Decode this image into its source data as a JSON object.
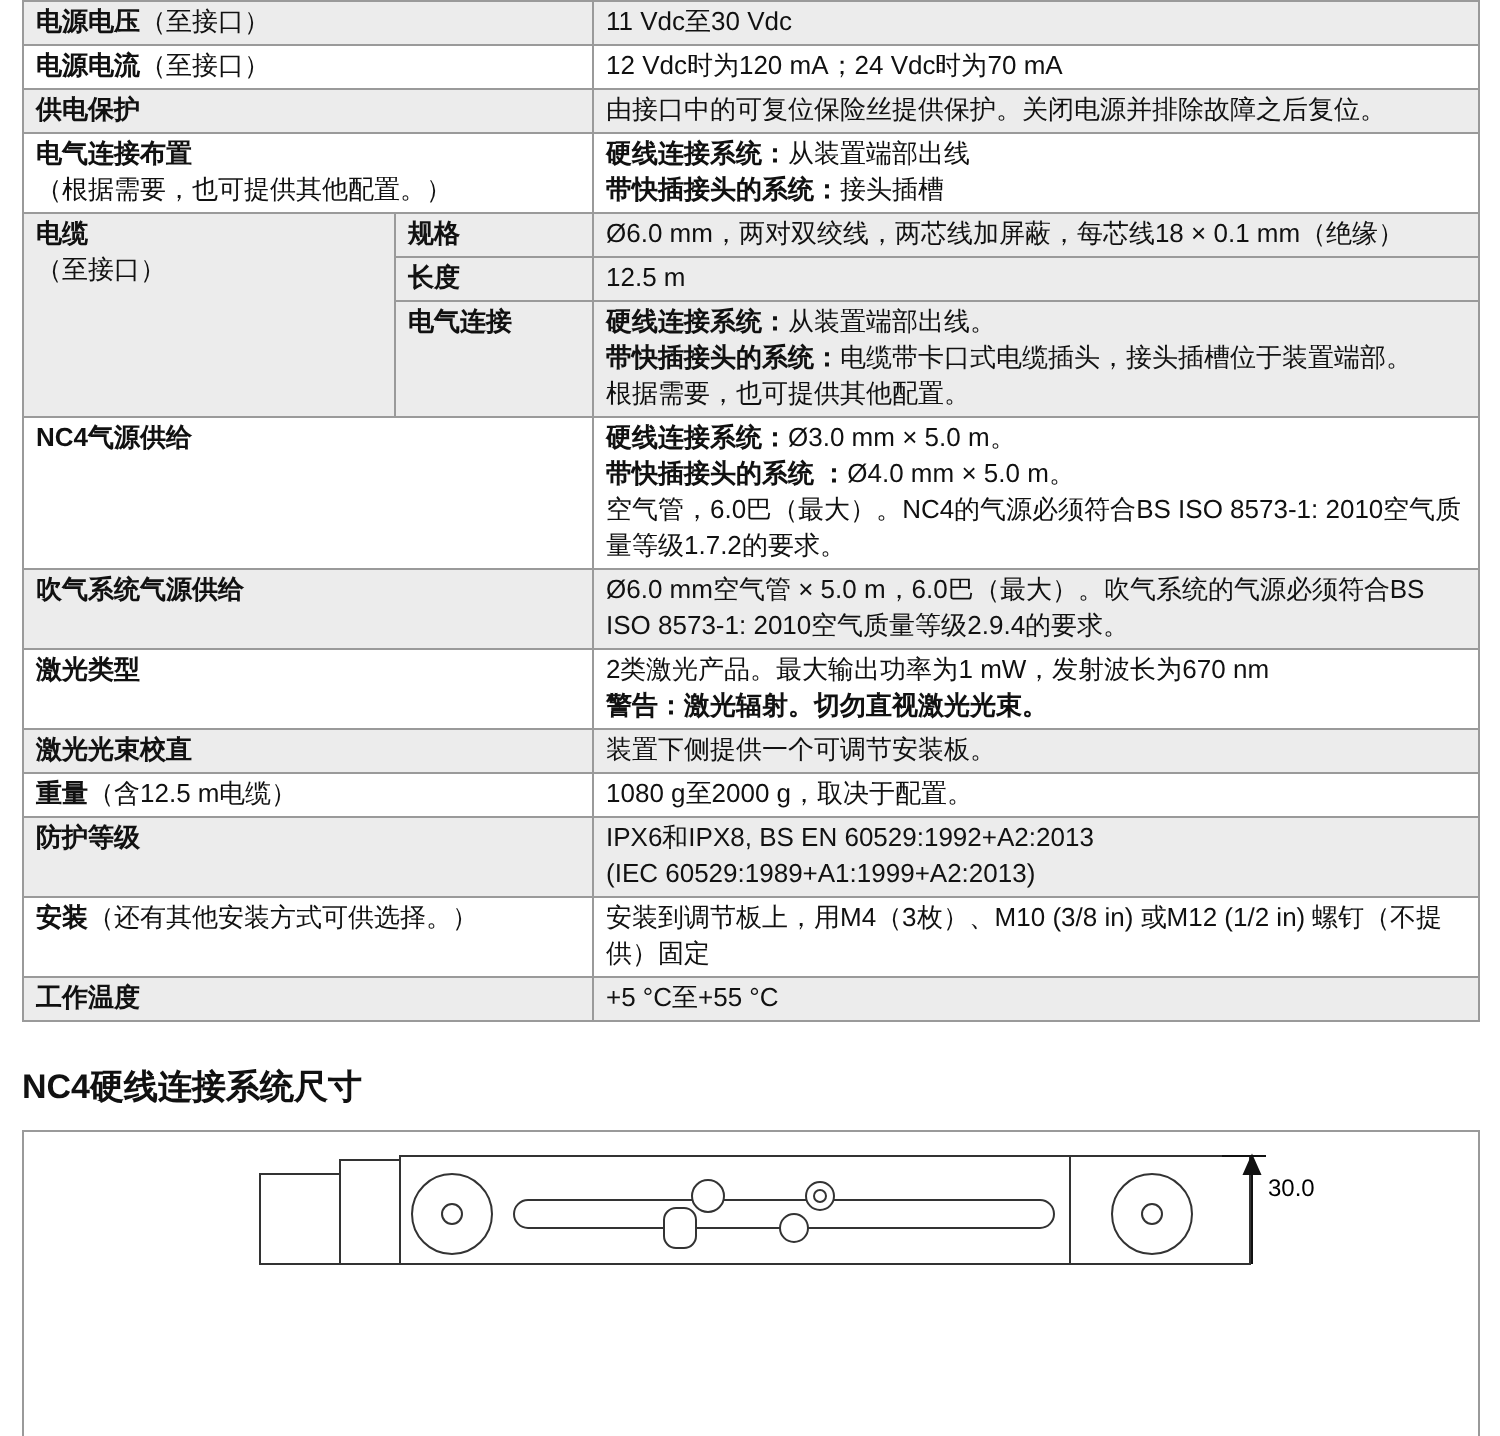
{
  "spec_table": {
    "rows": [
      {
        "label": [
          "**电源电压**（至接口）"
        ],
        "value": [
          "11 Vdc至30 Vdc"
        ]
      },
      {
        "label": [
          "**电源电流**（至接口）"
        ],
        "value": [
          "12 Vdc时为120 mA；24 Vdc时为70 mA"
        ]
      },
      {
        "label": [
          "**供电保护**"
        ],
        "value": [
          "由接口中的可复位保险丝提供保护。关闭电源并排除故障之后复位。"
        ]
      },
      {
        "label": [
          "**电气连接布置**",
          "（根据需要，也可提供其他配置。）"
        ],
        "value": [
          "**硬线连接系统：**从装置端部出线",
          "**带快插接头的系统：**接头插槽"
        ]
      },
      {
        "label": [
          "**电缆**",
          "（至接口）"
        ],
        "subrows": [
          {
            "label": "规格",
            "value": [
              "Ø6.0 mm，两对双绞线，两芯线加屏蔽，每芯线18 × 0.1 mm（绝缘）"
            ]
          },
          {
            "label": "长度",
            "value": [
              "12.5 m"
            ]
          },
          {
            "label": "电气连接",
            "value": [
              "**硬线连接系统：**从装置端部出线。",
              "**带快插接头的系统：**电缆带卡口式电缆插头，接头插槽位于装置端部。",
              "根据需要，也可提供其他配置。"
            ]
          }
        ]
      },
      {
        "label": [
          "**NC4气源供给**"
        ],
        "value": [
          "**硬线连接系统：**Ø3.0 mm × 5.0 m。",
          "**带快插接头的系统 ：**Ø4.0 mm × 5.0 m。",
          "空气管，6.0巴（最大）。NC4的气源必须符合BS ISO 8573-1: 2010空气质量等级1.7.2的要求。"
        ]
      },
      {
        "label": [
          "**吹气系统气源供给**"
        ],
        "value": [
          "Ø6.0 mm空气管 × 5.0 m，6.0巴（最大）。吹气系统的气源必须符合BS ISO 8573-1: 2010空气质量等级2.9.4的要求。"
        ]
      },
      {
        "label": [
          "**激光类型**"
        ],
        "value": [
          "2类激光产品。最大输出功率为1 mW，发射波长为670 nm",
          "**警告：激光辐射。切勿直视激光光束。**"
        ]
      },
      {
        "label": [
          "**激光光束校直**"
        ],
        "value": [
          "装置下侧提供一个可调节安装板。"
        ]
      },
      {
        "label": [
          "**重量**（含12.5 m电缆）"
        ],
        "value": [
          "1080 g至2000 g，取决于配置。"
        ]
      },
      {
        "label": [
          "**防护等级**"
        ],
        "value": [
          "IPX6和IPX8, BS EN 60529:1992+A2:2013",
          "(IEC 60529:1989+A1:1999+A2:2013)"
        ]
      },
      {
        "label": [
          "**安装**（还有其他安装方式可供选择。）"
        ],
        "value": [
          "安装到调节板上，用M4（3枚）、M10 (3/8 in) 或M12 (1/2 in) 螺钉（不提供）固定"
        ]
      },
      {
        "label": [
          "**工作温度**"
        ],
        "value": [
          "+5 °C至+55 °C"
        ]
      }
    ]
  },
  "section": {
    "title": "NC4硬线连接系统尺寸",
    "drawing": {
      "dimension": "30.0"
    }
  }
}
